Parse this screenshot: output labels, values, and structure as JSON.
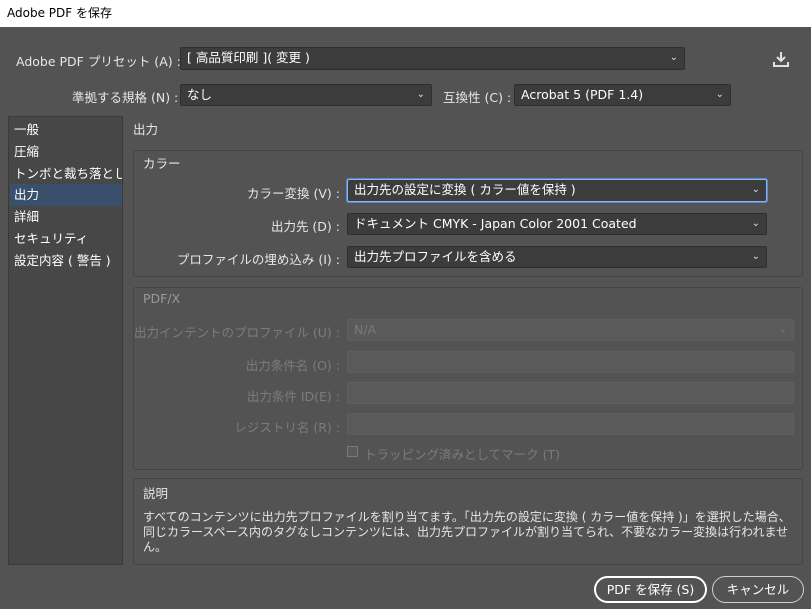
{
  "window": {
    "title": "Adobe PDF を保存"
  },
  "header": {
    "preset_label": "Adobe PDF プリセット (A) :",
    "preset_value": "[ 高品質印刷 ]( 変更 )",
    "standard_label": "準拠する規格 (N) :",
    "standard_value": "なし",
    "compat_label": "互換性 (C) :",
    "compat_value": "Acrobat 5 (PDF 1.4)",
    "save_preset_icon": "download-icon"
  },
  "sidebar": {
    "items": [
      {
        "label": "一般"
      },
      {
        "label": "圧縮"
      },
      {
        "label": "トンボと裁ち落とし"
      },
      {
        "label": "出力"
      },
      {
        "label": "詳細"
      },
      {
        "label": "セキュリティ"
      },
      {
        "label": "設定内容 ( 警告 )"
      }
    ],
    "active_index": 3
  },
  "main": {
    "section_title": "出力",
    "color": {
      "title": "カラー",
      "conversion_label": "カラー変換 (V) :",
      "conversion_value": "出力先の設定に変換 ( カラー値を保持 )",
      "destination_label": "出力先 (D) :",
      "destination_value": "ドキュメント CMYK - Japan Color 2001 Coated",
      "profile_label": "プロファイルの埋め込み (I) :",
      "profile_value": "出力先プロファイルを含める"
    },
    "pdfx": {
      "title": "PDF/X",
      "intent_label": "出力インテントのプロファイル (U) :",
      "intent_value": "N/A",
      "condition_name_label": "出力条件名 (O) :",
      "condition_id_label": "出力条件 ID(E) :",
      "registry_label": "レジストリ名 (R) :",
      "trapped_label": "トラッピング済みとしてマーク (T)"
    },
    "description": {
      "title": "説明",
      "text": "すべてのコンテンツに出力先プロファイルを割り当てます。「出力先の設定に変換 ( カラー値を保持 )」を選択した場合、同じカラースペース内のタグなしコンテンツには、出力先プロファイルが割り当てられ、不要なカラー変換は行われません。"
    }
  },
  "footer": {
    "save_label": "PDF を保存 (S)",
    "cancel_label": "キャンセル"
  },
  "icons": {
    "chevron": "chevron-down-icon"
  },
  "colors": {
    "background": "#535353",
    "selected": "#3a4f6b",
    "focus": "#8ab4f8"
  }
}
